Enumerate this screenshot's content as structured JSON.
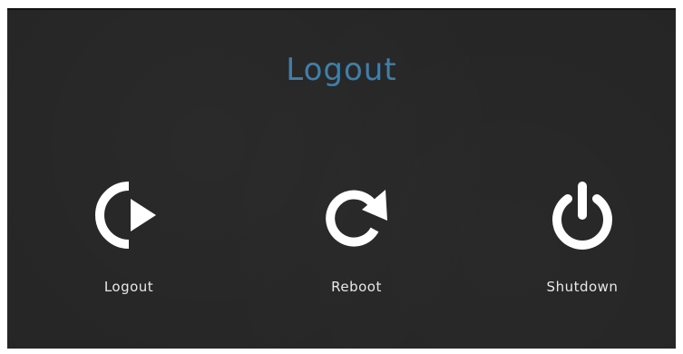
{
  "dialog": {
    "title": "Logout",
    "title_color": "#3f7fa8",
    "background_color": "#252525"
  },
  "actions": [
    {
      "label": "Logout",
      "icon": "logout-icon"
    },
    {
      "label": "Reboot",
      "icon": "reboot-icon"
    },
    {
      "label": "Shutdown",
      "icon": "power-icon"
    }
  ]
}
